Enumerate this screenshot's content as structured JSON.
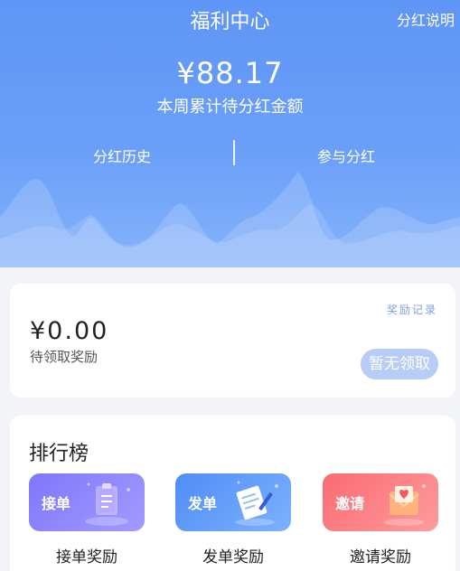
{
  "header": {
    "title": "福利中心",
    "explain_label": "分红说明",
    "amount": "¥88.17",
    "amount_label": "本周累计待分红金额",
    "history_label": "分红历史",
    "join_label": "参与分红"
  },
  "reward": {
    "amount": "¥0.00",
    "label": "待领取奖励",
    "record_label": "奖励记录",
    "claim_label": "暂无领取"
  },
  "ranking": {
    "title": "排行榜",
    "tiles": [
      {
        "badge": "接单",
        "caption": "接单奖励",
        "icon": "clipboard-icon"
      },
      {
        "badge": "发单",
        "caption": "发单奖励",
        "icon": "document-pen-icon"
      },
      {
        "badge": "邀请",
        "caption": "邀请奖励",
        "icon": "heart-envelope-icon"
      }
    ]
  },
  "colors": {
    "hero": "#6a9ff8",
    "claim_button": "#b7cdf6",
    "tile_order": "#8b83fc",
    "tile_post": "#5f9af9",
    "tile_invite": "#fc7b82"
  }
}
